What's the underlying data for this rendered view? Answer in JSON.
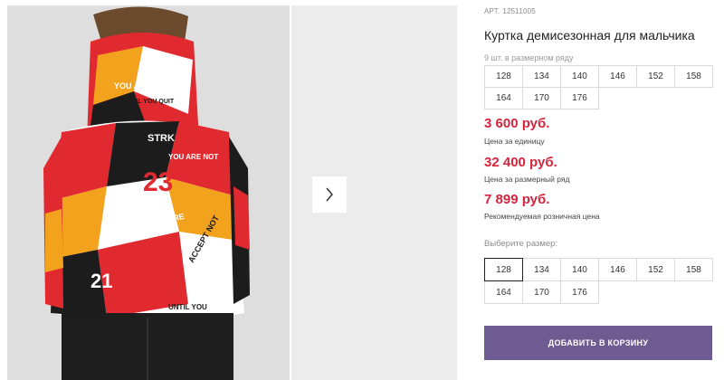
{
  "gallery": {
    "next_icon": "chevron-right-icon",
    "jacket_prints": [
      "YOU ARE NOT",
      "UNTIL YOU QUIT",
      "23",
      "ACCEPT FAILURE",
      "ACCEPT NOT",
      "21",
      "STRK",
      "YOU ARE NOT",
      "UNTIL YOU"
    ]
  },
  "product": {
    "article_label": "АРТ.",
    "article_number": "12511005",
    "title": "Куртка демисезонная для мальчика",
    "series_note": "9 шт. в размерном ряду",
    "series_sizes": [
      "128",
      "134",
      "140",
      "146",
      "152",
      "158",
      "164",
      "170",
      "176"
    ],
    "price_unit": "3 600 руб.",
    "price_unit_label": "Цена за единицу",
    "price_series": "32 400 руб.",
    "price_series_label": "Цена за размерный ряд",
    "price_retail": "7 899 руб.",
    "price_retail_label": "Рекомендуемая розничная цена",
    "choose_size_label": "Выберите размер:",
    "sizes": [
      "128",
      "134",
      "140",
      "146",
      "152",
      "158",
      "164",
      "170",
      "176"
    ],
    "selected_size": "128",
    "add_to_cart": "ДОБАВИТЬ В КОРЗИНУ"
  },
  "colors": {
    "price": "#d6243c",
    "button": "#6e5b92",
    "jacket_red": "#e02a30",
    "jacket_orange": "#f2a21c",
    "jacket_black": "#1c1c1c"
  }
}
